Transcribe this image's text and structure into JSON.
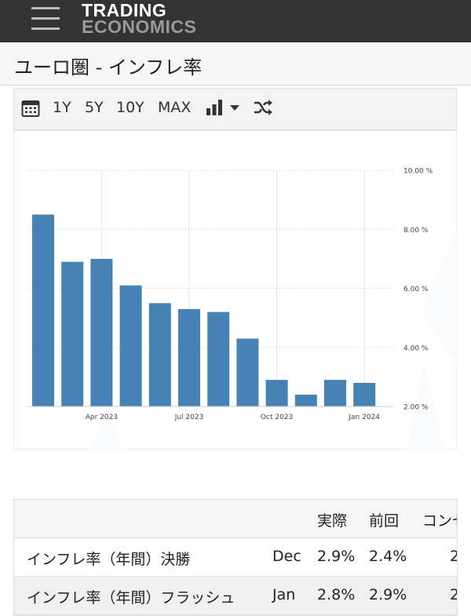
{
  "header": {
    "logo_line1": "TRADING",
    "logo_line2": "ECONOMICS"
  },
  "page_title": "ユーロ圏 - インフレ率",
  "toolbar": {
    "ranges": [
      "1Y",
      "5Y",
      "10Y",
      "MAX"
    ],
    "icons": [
      "calendar-icon",
      "bar-chart-icon",
      "dropdown-caret-icon",
      "shuffle-icon"
    ]
  },
  "chart_data": {
    "type": "bar",
    "color": "#4682b4",
    "categories": [
      "2023-02",
      "2023-03",
      "2023-04",
      "2023-05",
      "2023-06",
      "2023-07",
      "2023-08",
      "2023-09",
      "2023-10",
      "2023-11",
      "2023-12",
      "2024-01"
    ],
    "values": [
      8.5,
      6.9,
      7.0,
      6.1,
      5.5,
      5.3,
      5.2,
      4.3,
      2.9,
      2.4,
      2.9,
      2.8
    ],
    "x_tick_labels": [
      "Apr 2023",
      "Jul 2023",
      "Oct 2023",
      "Jan 2024"
    ],
    "x_tick_categories": [
      "2023-04",
      "2023-07",
      "2023-10",
      "2024-01"
    ],
    "y_ticks": [
      2,
      4,
      6,
      8,
      10
    ],
    "y_tick_labels": [
      "2.00 %",
      "4.00 %",
      "6.00 %",
      "8.00 %",
      "10.00 %"
    ],
    "ylim": [
      2,
      10
    ],
    "grid": true,
    "title": "",
    "xlabel": "",
    "ylabel": ""
  },
  "table": {
    "headers": [
      "",
      "",
      "実際",
      "前回",
      "コンセ"
    ],
    "rows": [
      {
        "name": "インフレ率（年間）決勝",
        "period": "Dec",
        "actual": "2.9%",
        "previous": "2.4%",
        "consensus": "2"
      },
      {
        "name": "インフレ率（年間）フラッシュ",
        "period": "Jan",
        "actual": "2.8%",
        "previous": "2.9%",
        "consensus": "2"
      }
    ]
  }
}
